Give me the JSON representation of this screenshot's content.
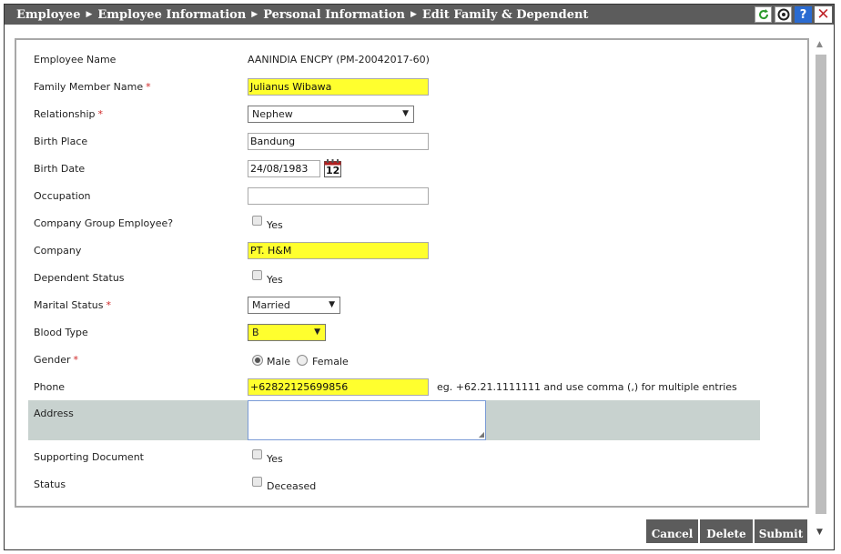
{
  "breadcrumb": [
    "Employee",
    "Employee Information",
    "Personal Information",
    "Edit Family & Dependent"
  ],
  "toolbar": {
    "icons": [
      "refresh-icon",
      "gear-icon",
      "help-icon",
      "close-icon"
    ],
    "help_glyph": "?",
    "close_glyph": "✕"
  },
  "form": {
    "employee_name": {
      "label": "Employee Name",
      "value": "AANINDIA ENCPY (PM-20042017-60)"
    },
    "family_member_name": {
      "label": "Family Member Name",
      "value": "Julianus Wibawa",
      "required": "*"
    },
    "relationship": {
      "label": "Relationship",
      "value": "Nephew",
      "required": "*"
    },
    "birth_place": {
      "label": "Birth Place",
      "value": "Bandung"
    },
    "birth_date": {
      "label": "Birth Date",
      "value": "24/08/1983",
      "calendar_day": "12"
    },
    "occupation": {
      "label": "Occupation",
      "value": ""
    },
    "company_group_employee": {
      "label": "Company Group Employee?",
      "option": "Yes"
    },
    "company": {
      "label": "Company",
      "value": "PT. H&M"
    },
    "dependent_status": {
      "label": "Dependent Status",
      "option": "Yes"
    },
    "marital_status": {
      "label": "Marital Status",
      "value": "Married",
      "required": "*"
    },
    "blood_type": {
      "label": "Blood Type",
      "value": "B"
    },
    "gender": {
      "label": "Gender",
      "required": "*",
      "options": [
        "Male",
        "Female"
      ],
      "selected": "Male"
    },
    "phone": {
      "label": "Phone",
      "value": "+62822125699856",
      "hint": "eg. +62.21.1111111 and use comma (,) for multiple entries"
    },
    "address": {
      "label": "Address",
      "value": ""
    },
    "supporting_document": {
      "label": "Supporting Document",
      "option": "Yes"
    },
    "status": {
      "label": "Status",
      "option": "Deceased"
    }
  },
  "buttons": {
    "cancel": "Cancel",
    "delete": "Delete",
    "submit": "Submit"
  },
  "colors": {
    "titlebar": "#5c5c5c",
    "highlight": "#ffff2e",
    "address_row": "#c8d2cf",
    "required": "#d02828"
  }
}
